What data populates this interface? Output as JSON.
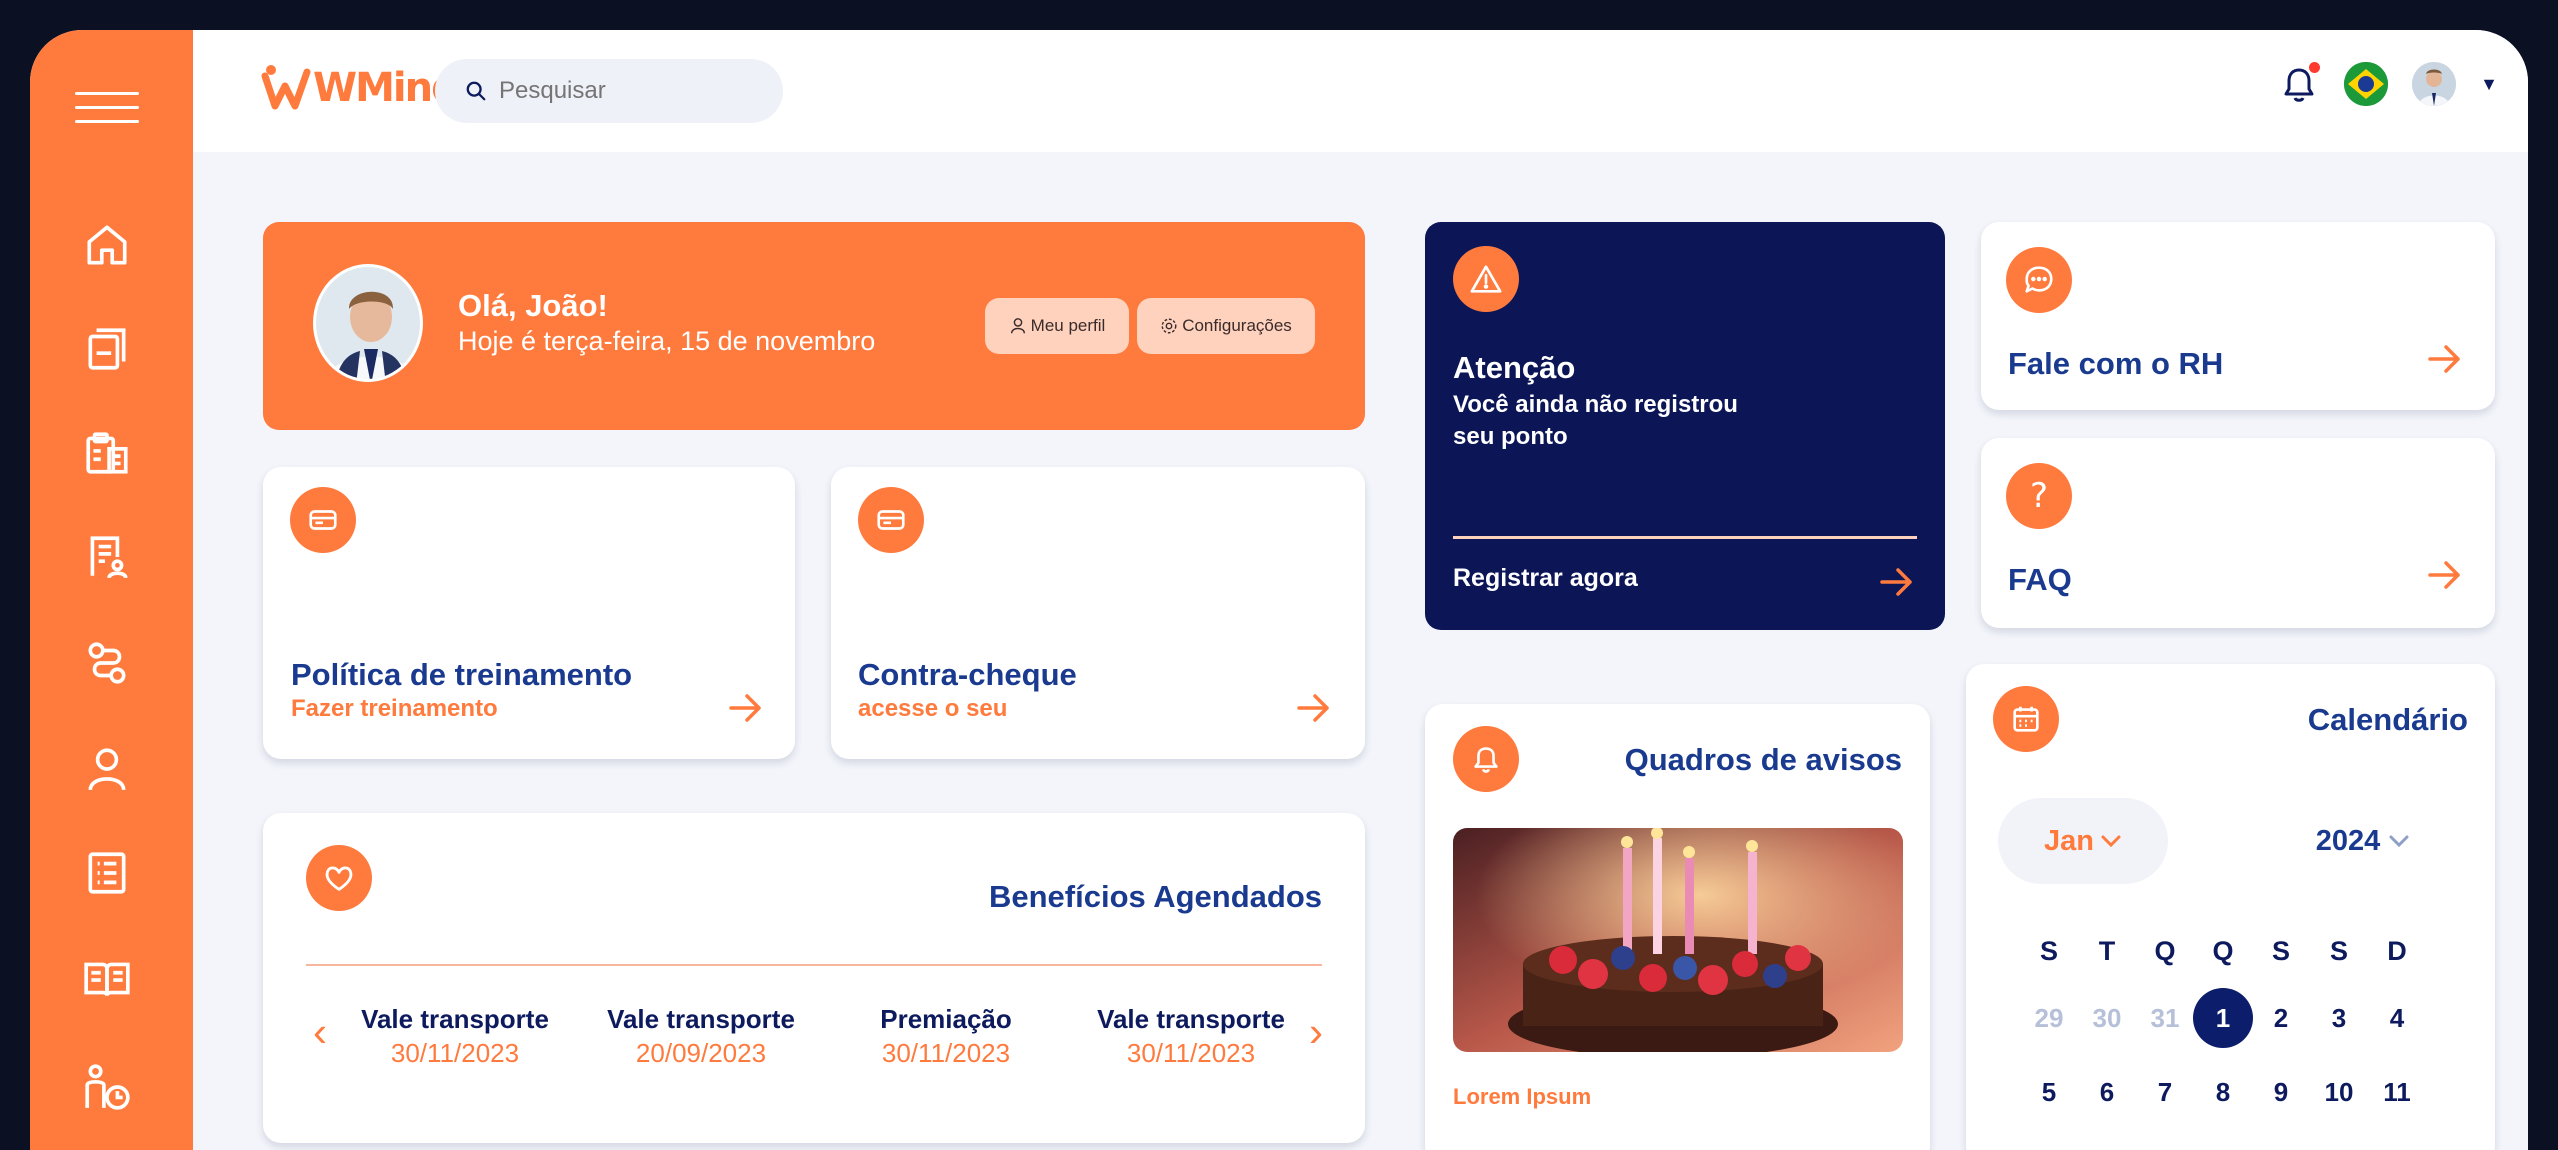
{
  "app": {
    "logo": "WMind"
  },
  "search": {
    "placeholder": "Pesquisar"
  },
  "welcome": {
    "greeting": "Olá, João!",
    "date": "Hoje é terça-feira, 15 de novembro",
    "profile_button": "Meu perfil",
    "settings_button": "Configurações"
  },
  "cards": {
    "training": {
      "title": "Política de treinamento",
      "subtitle": "Fazer treinamento"
    },
    "payslip": {
      "title": "Contra-cheque",
      "subtitle": "acesse o seu"
    }
  },
  "alert": {
    "title": "Atenção",
    "message": "Você ainda não registrou seu ponto",
    "cta": "Registrar agora"
  },
  "hr": {
    "title": "Fale com o RH"
  },
  "faq": {
    "title": "FAQ"
  },
  "notices": {
    "title": "Quadros de avisos",
    "item_preview": "Lorem Ipsum"
  },
  "benefits": {
    "title": "Benefícios Agendados",
    "items": [
      {
        "name": "Vale transporte",
        "date": "30/11/2023"
      },
      {
        "name": "Vale transporte",
        "date": "20/09/2023"
      },
      {
        "name": "Premiação",
        "date": "30/11/2023"
      },
      {
        "name": "Vale transporte",
        "date": "30/11/2023"
      }
    ]
  },
  "calendar": {
    "title": "Calendário",
    "month": "Jan",
    "year": "2024",
    "weekdays": [
      "S",
      "T",
      "Q",
      "Q",
      "S",
      "S",
      "D"
    ],
    "week1": [
      "29",
      "30",
      "31",
      "1",
      "2",
      "3",
      "4"
    ],
    "week2": [
      "5",
      "6",
      "7",
      "8",
      "9",
      "10",
      "11"
    ],
    "selected": "1"
  },
  "colors": {
    "accent": "#ff7a3d",
    "navy": "#0c1657",
    "title_blue": "#1a3a8f",
    "background": "#f3f5fb"
  }
}
